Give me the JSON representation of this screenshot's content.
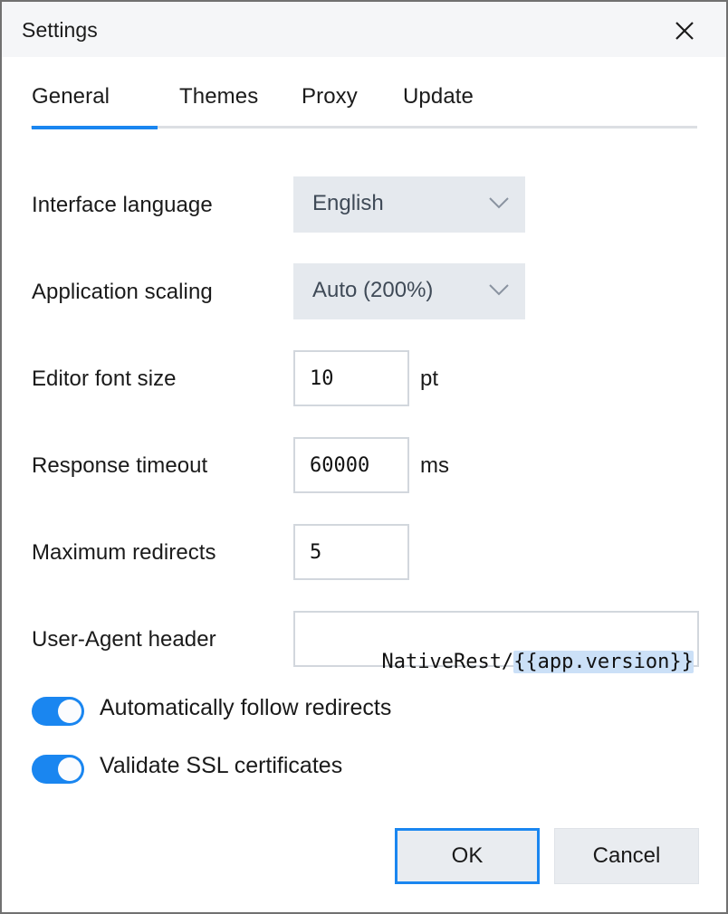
{
  "window": {
    "title": "Settings",
    "close_icon": "close-icon",
    "border_color": "#717171",
    "titlebar_bg": "#f5f6f8"
  },
  "tabs": {
    "active_index": 0,
    "accent_color": "#1a86f0",
    "items": [
      {
        "label": "General"
      },
      {
        "label": "Themes"
      },
      {
        "label": "Proxy"
      },
      {
        "label": "Update"
      }
    ]
  },
  "form": {
    "interface_language": {
      "label": "Interface language",
      "value": "English",
      "chevron_icon": "chevron-down-icon"
    },
    "application_scaling": {
      "label": "Application scaling",
      "value": "Auto (200%)",
      "chevron_icon": "chevron-down-icon"
    },
    "editor_font_size": {
      "label": "Editor font size",
      "value": "10",
      "unit": "pt"
    },
    "response_timeout": {
      "label": "Response timeout",
      "value": "60000",
      "unit": "ms"
    },
    "maximum_redirects": {
      "label": "Maximum redirects",
      "value": "5",
      "unit": ""
    },
    "user_agent_header": {
      "label": "User-Agent header",
      "value_prefix": "NativeRest/",
      "value_template": "{{app.version}}",
      "highlight_color": "#cbe0f7"
    }
  },
  "toggles": [
    {
      "label": "Automatically follow redirects",
      "on": true
    },
    {
      "label": "Validate SSL certificates",
      "on": true
    }
  ],
  "footer": {
    "ok_label": "OK",
    "cancel_label": "Cancel"
  }
}
